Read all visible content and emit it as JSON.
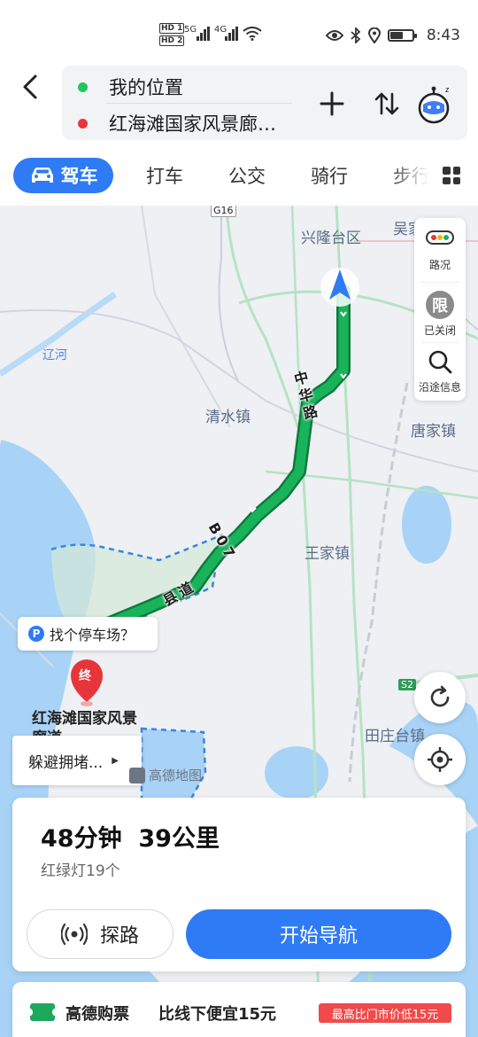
{
  "status_bar": {
    "network_badges": [
      "HD 1",
      "HD 2"
    ],
    "signal_1": "5G",
    "signal_2": "4G",
    "time": "8:43"
  },
  "route": {
    "origin": "我的位置",
    "destination": "红海滩国家风景廊…",
    "origin_color": "#1ec760",
    "destination_color": "#e8353b"
  },
  "tabs": [
    {
      "label": "驾车",
      "active": true
    },
    {
      "label": "打车"
    },
    {
      "label": "公交"
    },
    {
      "label": "骑行"
    },
    {
      "label": "步行"
    }
  ],
  "map": {
    "labels": {
      "xinglongtai": "兴隆台区",
      "wujia": "吴家",
      "liaohe": "辽河",
      "qingshui": "清水镇",
      "tangjia": "唐家镇",
      "wangjia": "王家镇",
      "tianzhuangtai": "田庄台镇",
      "g16": "G16",
      "s2": "S2"
    },
    "road_names": {
      "zhonghua": "中华路",
      "b07": "B07",
      "xiandao": "县道"
    },
    "destination_poi": "红海滩国家风景廊道",
    "destination_marker": "终",
    "side_panel": {
      "traffic": "路况",
      "restriction_badge": "限",
      "restriction": "已关闭",
      "along_route": "沿途信息"
    },
    "parking_prompt": "找个停车场？",
    "parking_badge": "P",
    "avoid_congestion": "躲避拥堵...",
    "logo_text": "高德地图",
    "route_color": "#19b35c",
    "water_color": "#a8d3f6"
  },
  "summary": {
    "duration_distance": "48分钟  39公里",
    "traffic_lights": "红绿灯19个",
    "explore_label": "探路",
    "start_label": "开始导航",
    "accent_color": "#2f7af5"
  },
  "ticket": {
    "brand": "高德购票",
    "promo": "比线下便宜15元",
    "badge": "最高比门市价低15元"
  }
}
